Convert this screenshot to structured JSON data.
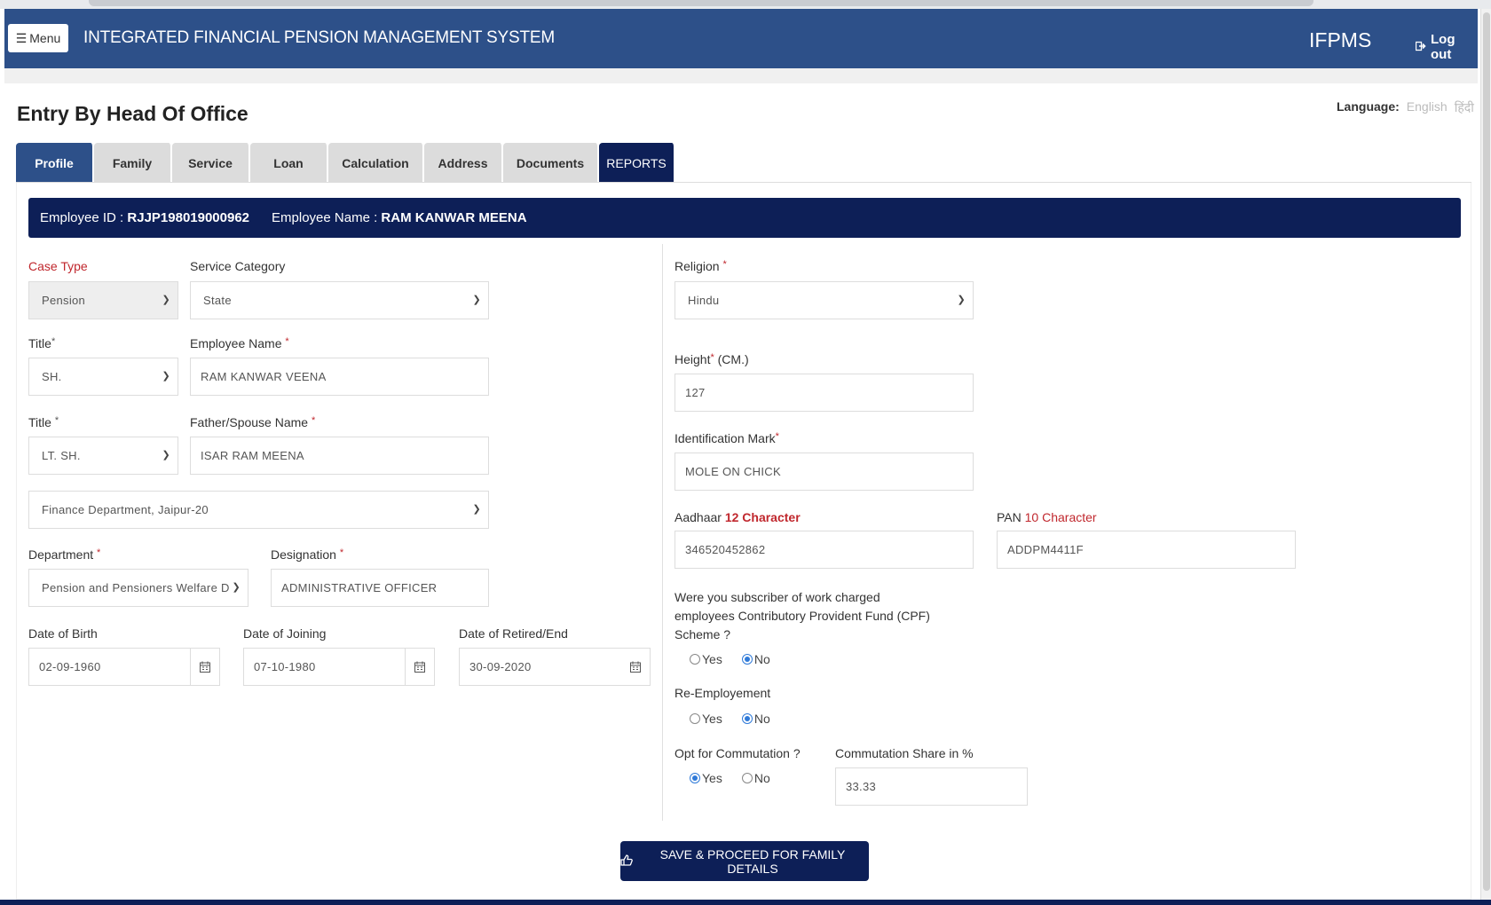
{
  "navbar": {
    "menu_label": "Menu",
    "title": "INTEGRATED FINANCIAL PENSION MANAGEMENT SYSTEM",
    "brand": "IFPMS",
    "logout_label": "Log out"
  },
  "page": {
    "title": "Entry By Head Of Office",
    "language_label": "Language:",
    "language_options": [
      "English",
      "हिंदी"
    ]
  },
  "tabs": [
    {
      "label": "Profile",
      "active": true
    },
    {
      "label": "Family"
    },
    {
      "label": "Service"
    },
    {
      "label": "Loan"
    },
    {
      "label": "Calculation"
    },
    {
      "label": "Address"
    },
    {
      "label": "Documents"
    },
    {
      "label": "REPORTS"
    }
  ],
  "employee": {
    "id_label": "Employee ID :",
    "id": "RJJP198019000962",
    "name_label": "Employee Name :",
    "name": "RAM KANWAR MEENA"
  },
  "form": {
    "case_type": {
      "label": "Case Type",
      "value": "Pension"
    },
    "service_category": {
      "label": "Service Category",
      "value": "State"
    },
    "title1": {
      "label": "Title",
      "value": "SH."
    },
    "employee_name": {
      "label": "Employee Name",
      "value": "RAM KANWAR VEENA"
    },
    "title2": {
      "label": "Title",
      "value": "LT. SH."
    },
    "father_spouse_name": {
      "label": "Father/Spouse Name",
      "value": "ISAR RAM MEENA"
    },
    "office": {
      "value": "Finance Department, Jaipur-20"
    },
    "department": {
      "label": "Department",
      "value": "Pension and Pensioners Welfare D"
    },
    "designation": {
      "label": "Designation",
      "value": "ADMINISTRATIVE OFFICER"
    },
    "date_of_birth": {
      "label": "Date of Birth",
      "value": "02-09-1960"
    },
    "date_of_joining": {
      "label": "Date of Joining",
      "value": "07-10-1980"
    },
    "date_of_retired": {
      "label": "Date of Retired/End",
      "value": "30-09-2020"
    },
    "religion": {
      "label": "Religion",
      "value": "Hindu"
    },
    "height": {
      "label": "Height",
      "unit": "(CM.)",
      "value": "127"
    },
    "identification_mark": {
      "label": "Identification Mark",
      "value": "MOLE ON CHICK"
    },
    "aadhaar": {
      "label": "Aadhaar",
      "hint": "12 Character",
      "value": "346520452862"
    },
    "pan": {
      "label": "PAN",
      "hint": "10 Character",
      "value": "ADDPM4411F"
    },
    "cpf": {
      "question_lines": [
        "Were you subscriber of work charged",
        "employees Contributory Provident Fund (CPF)",
        "Scheme ?"
      ],
      "options": [
        "Yes",
        "No"
      ],
      "selected": "No"
    },
    "re_employment": {
      "label": "Re-Employement",
      "options": [
        "Yes",
        "No"
      ],
      "selected": "No"
    },
    "commutation": {
      "label": "Opt for Commutation ?",
      "options": [
        "Yes",
        "No"
      ],
      "selected": "Yes"
    },
    "commutation_share": {
      "label": "Commutation Share in %",
      "value": "33.33"
    }
  },
  "actions": {
    "save_label": "SAVE & PROCEED FOR FAMILY DETAILS"
  },
  "colors": {
    "navbar": "#2d5089",
    "dark_navy": "#0d1f57",
    "required": "#c0272d",
    "radio_selected": "#2f7ad8"
  }
}
